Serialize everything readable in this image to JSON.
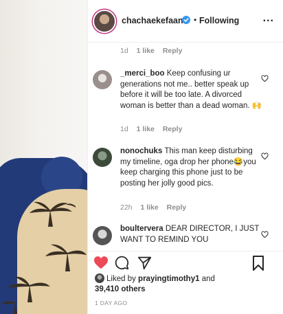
{
  "post": {
    "username": "chachaekefaani",
    "separator": "•",
    "follow_status": "Following",
    "more_label": "..."
  },
  "comments": [
    {
      "time": "1d",
      "likes": "1 like",
      "reply": "Reply"
    },
    {
      "username": "_merci_boo",
      "text": "Keep confusing ur generations not me.. better speak up before it will be too late. A divorced woman is better than a dead woman. 🙌",
      "time": "1d",
      "likes": "1 like",
      "reply": "Reply"
    },
    {
      "username": "nonochuks",
      "text": "This man keep disturbing my timeline, oga drop her phone😂you keep charging this phone just to be posting her jolly good pics.",
      "time": "22h",
      "likes": "1 like",
      "reply": "Reply"
    },
    {
      "username": "boultervera",
      "text": "DEAR DIRECTOR, I JUST WANT TO REMIND YOU"
    }
  ],
  "likes": {
    "prefix": "Liked by",
    "user": "prayingtimothy1",
    "conj": "and",
    "count": "39,410 others"
  },
  "timestamp": "1 DAY AGO",
  "colors": {
    "liked_heart": "#ed4956",
    "verified": "#3897f0",
    "muted_text": "#8e8e8e"
  }
}
